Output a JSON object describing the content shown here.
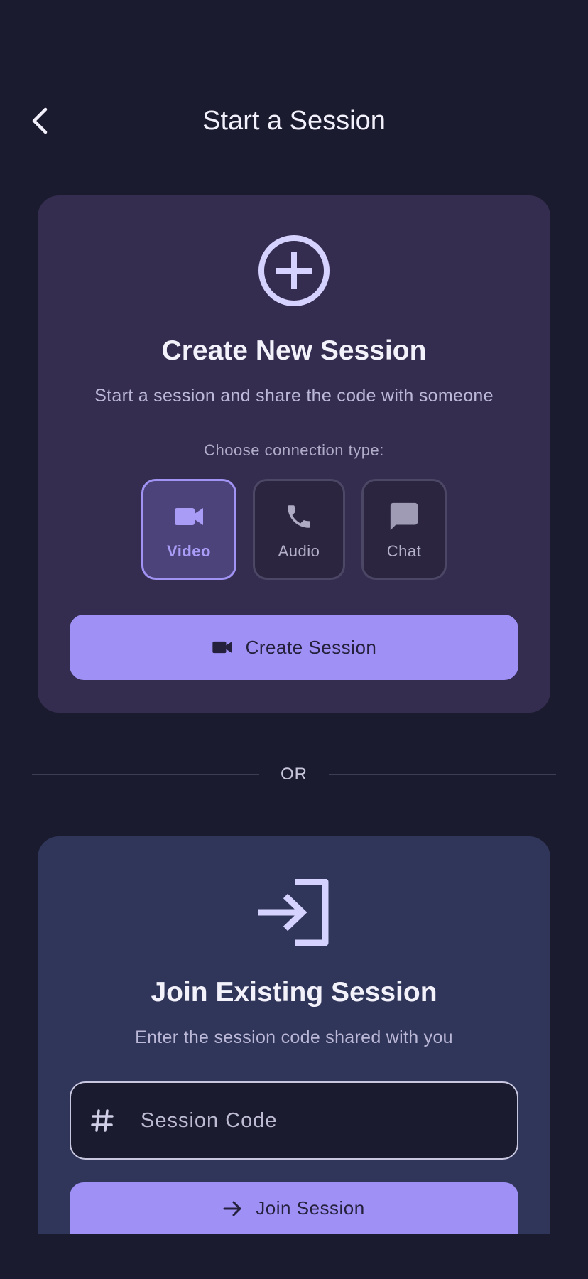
{
  "header": {
    "title": "Start a Session"
  },
  "create": {
    "title": "Create New Session",
    "subtitle": "Start a session and share the code with someone",
    "choose_label": "Choose connection type:",
    "connection_types": [
      {
        "label": "Video",
        "icon": "video-camera-icon",
        "selected": true
      },
      {
        "label": "Audio",
        "icon": "phone-icon",
        "selected": false
      },
      {
        "label": "Chat",
        "icon": "chat-bubble-icon",
        "selected": false
      }
    ],
    "button_label": "Create Session",
    "button_icon": "video-camera-icon"
  },
  "divider": {
    "text": "OR"
  },
  "join": {
    "title": "Join Existing Session",
    "subtitle": "Enter the session code shared with you",
    "code_placeholder": "Session Code",
    "code_value": "",
    "button_label": "Join Session",
    "button_icon": "arrow-right-icon"
  },
  "colors": {
    "background": "#1b1b2f",
    "create_card": "#342d4f",
    "join_card": "#30365a",
    "accent": "#9e90f5",
    "selected_border": "#a193f4"
  }
}
